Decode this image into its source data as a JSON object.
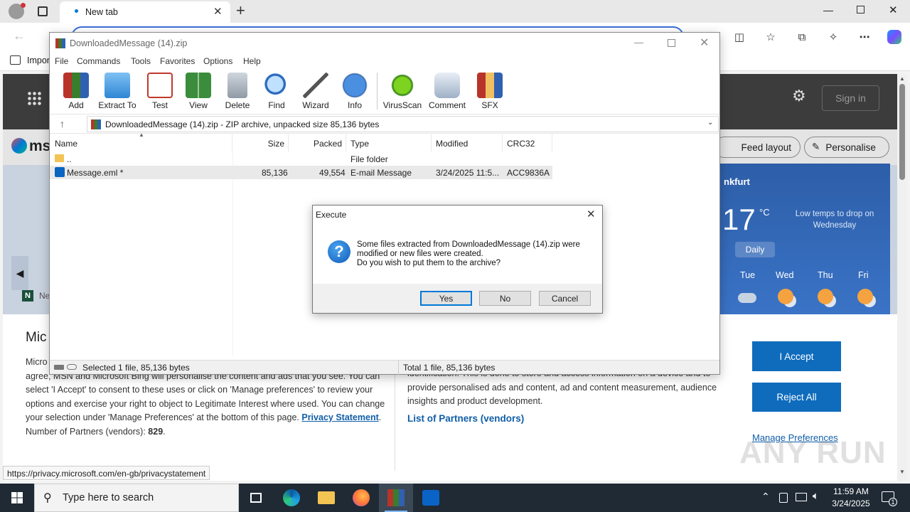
{
  "browser": {
    "tab_title": "New tab",
    "favorites_item": "Impor"
  },
  "msn": {
    "brand": "ms",
    "sign_in": "Sign in",
    "feed_layout": "Feed layout",
    "personalise": "Personalise",
    "news_fragment": "Ne",
    "weather": {
      "city": "nkfurt",
      "temp": "17",
      "unit": "°C",
      "note": "Low temps to drop on Wednesday",
      "tab": "Daily",
      "days": [
        "Tue",
        "Wed",
        "Thu",
        "Fri"
      ]
    },
    "consent": {
      "heading": "Mic",
      "left_text": "Micro such as unique IDs to deliver, maintain and improve our services and ads. If you agree, MSN and Microsoft Bing will personalise the content and ads that you see. You can select 'I Accept' to consent to these uses or click on 'Manage preferences' to review your options and exercise your right to object to Legitimate Interest where used. You can change your selection under 'Manage Preferences' at the bottom of this page.",
      "privacy_link": "Privacy Statement",
      "partners_label": "Number of Partners (vendors):",
      "partners_count": "829",
      "middle_text": "identification. This is done to store and access information on a device and to provide personalised ads and content, ad and content measurement, audience insights and product development.",
      "vendors_link": "List of Partners (vendors)",
      "accept": "I Accept",
      "reject": "Reject All",
      "manage": "Manage Preferences"
    },
    "status_url": "https://privacy.microsoft.com/en-gb/privacystatement"
  },
  "winrar": {
    "title": "DownloadedMessage (14).zip",
    "menu": [
      "File",
      "Commands",
      "Tools",
      "Favorites",
      "Options",
      "Help"
    ],
    "tools": [
      "Add",
      "Extract To",
      "Test",
      "View",
      "Delete",
      "Find",
      "Wizard",
      "Info",
      "VirusScan",
      "Comment",
      "SFX"
    ],
    "path": "DownloadedMessage (14).zip - ZIP archive, unpacked size 85,136 bytes",
    "columns": [
      "Name",
      "Size",
      "Packed",
      "Type",
      "Modified",
      "CRC32"
    ],
    "rows": [
      {
        "name": "..",
        "size": "",
        "packed": "",
        "type": "File folder",
        "modified": "",
        "crc": ""
      },
      {
        "name": "Message.eml *",
        "size": "85,136",
        "packed": "49,554",
        "type": "E-mail Message",
        "modified": "3/24/2025 11:5...",
        "crc": "ACC9836A"
      }
    ],
    "status_left": "Selected 1 file, 85,136 bytes",
    "status_right": "Total 1 file, 85,136 bytes"
  },
  "dialog": {
    "title": "Execute",
    "message_1": "Some files extracted from DownloadedMessage (14).zip were",
    "message_2": "modified or new files were created.",
    "message_3": "Do you wish to put them to the archive?",
    "yes": "Yes",
    "no": "No",
    "cancel": "Cancel"
  },
  "taskbar": {
    "search_placeholder": "Type here to search",
    "time": "11:59 AM",
    "date": "3/24/2025",
    "notification_count": "1"
  },
  "watermark": "ANY RUN"
}
